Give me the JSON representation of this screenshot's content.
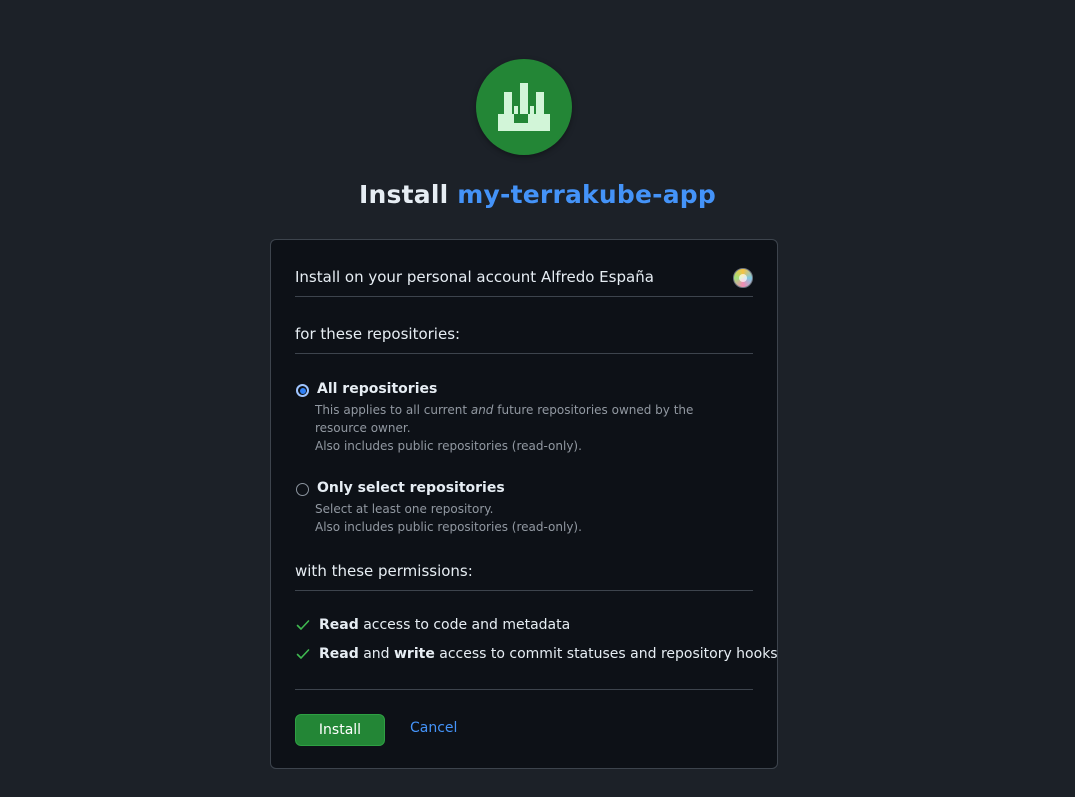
{
  "header": {
    "title_prefix": "Install",
    "app_name": "my-terrakube-app"
  },
  "account": {
    "text": "Install on your personal account Alfredo España"
  },
  "repositories": {
    "heading": "for these repositories:",
    "options": [
      {
        "label": "All repositories",
        "selected": true,
        "desc_before": "This applies to all current ",
        "desc_em": "and",
        "desc_after": " future repositories owned by the resource owner.",
        "desc_line2": "Also includes public repositories (read-only)."
      },
      {
        "label": "Only select repositories",
        "selected": false,
        "desc_line1": "Select at least one repository.",
        "desc_line2": "Also includes public repositories (read-only)."
      }
    ]
  },
  "permissions": {
    "heading": "with these permissions:",
    "items": [
      {
        "bold1": "Read",
        "rest": " access to code and metadata"
      },
      {
        "bold1": "Read",
        "mid": " and ",
        "bold2": "write",
        "rest": " access to commit statuses and repository hooks"
      }
    ]
  },
  "actions": {
    "install_label": "Install",
    "cancel_label": "Cancel"
  },
  "colors": {
    "background": "#1c2128",
    "card": "#0d1117",
    "accent_green": "#238636",
    "link_blue": "#4493f8"
  }
}
